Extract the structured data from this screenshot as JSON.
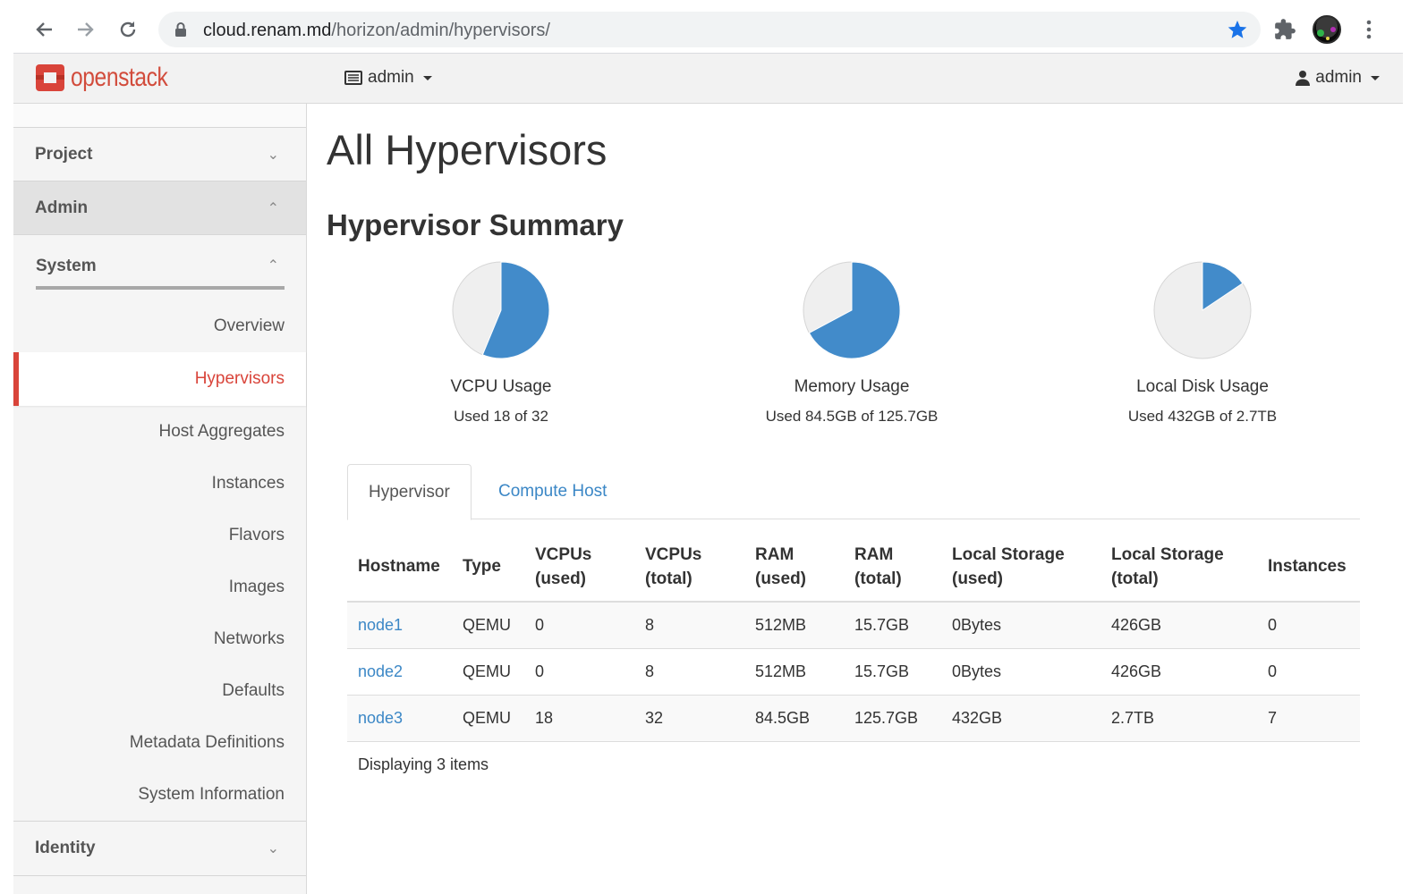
{
  "browser": {
    "url_host": "cloud.renam.md",
    "url_path": "/horizon/admin/hypervisors/"
  },
  "header": {
    "logo_text": "openstack",
    "project_label": "admin",
    "user_label": "admin"
  },
  "sidebar": {
    "project_label": "Project",
    "admin_label": "Admin",
    "system_label": "System",
    "items": [
      {
        "label": "Overview"
      },
      {
        "label": "Hypervisors"
      },
      {
        "label": "Host Aggregates"
      },
      {
        "label": "Instances"
      },
      {
        "label": "Flavors"
      },
      {
        "label": "Images"
      },
      {
        "label": "Networks"
      },
      {
        "label": "Defaults"
      },
      {
        "label": "Metadata Definitions"
      },
      {
        "label": "System Information"
      }
    ],
    "identity_label": "Identity"
  },
  "main": {
    "title": "All Hypervisors",
    "summary_title": "Hypervisor Summary",
    "charts": [
      {
        "label": "VCPU Usage",
        "sub": "Used 18 of 32",
        "used_fraction": 0.5625
      },
      {
        "label": "Memory Usage",
        "sub": "Used 84.5GB of 125.7GB",
        "used_fraction": 0.672
      },
      {
        "label": "Local Disk Usage",
        "sub": "Used 432GB of 2.7TB",
        "used_fraction": 0.156
      }
    ],
    "tabs": [
      {
        "label": "Hypervisor"
      },
      {
        "label": "Compute Host"
      }
    ],
    "table": {
      "headers": [
        "Hostname",
        "Type",
        "VCPUs (used)",
        "VCPUs (total)",
        "RAM (used)",
        "RAM (total)",
        "Local Storage (used)",
        "Local Storage (total)",
        "Instances"
      ],
      "rows": [
        [
          "node1",
          "QEMU",
          "0",
          "8",
          "512MB",
          "15.7GB",
          "0Bytes",
          "426GB",
          "0"
        ],
        [
          "node2",
          "QEMU",
          "0",
          "8",
          "512MB",
          "15.7GB",
          "0Bytes",
          "426GB",
          "0"
        ],
        [
          "node3",
          "QEMU",
          "18",
          "32",
          "84.5GB",
          "125.7GB",
          "432GB",
          "2.7TB",
          "7"
        ]
      ]
    },
    "footer": "Displaying 3 items"
  },
  "colors": {
    "pie_used": "#428bca",
    "pie_free": "#efefef",
    "active_red": "#d9443a",
    "link_blue": "#3b87c6"
  }
}
